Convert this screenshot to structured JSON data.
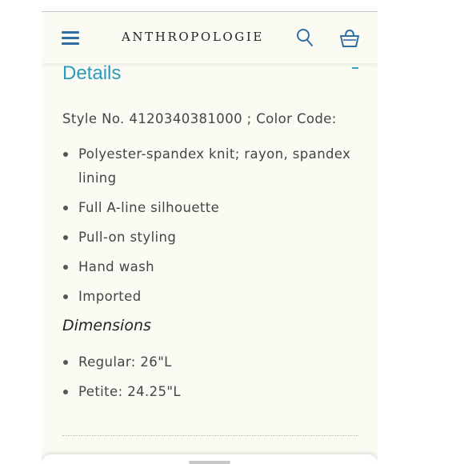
{
  "header": {
    "brand": "ANTHROPOLOGIE",
    "icons": [
      "menu-icon",
      "search-icon",
      "shopping-bag-icon"
    ],
    "accent_color": "#2f6fa4"
  },
  "details": {
    "title": "Details",
    "title_color": "#2a9bbb",
    "style_line": "Style No. 4120340381000 ; Color Code:",
    "features": [
      "Polyester-spandex knit; rayon, spandex lining",
      "Full A-line silhouette",
      "Pull-on styling",
      "Hand wash",
      "Imported"
    ]
  },
  "dimensions": {
    "title": "Dimensions",
    "items": [
      "Regular: 26\"L",
      "Petite: 24.25\"L"
    ]
  }
}
